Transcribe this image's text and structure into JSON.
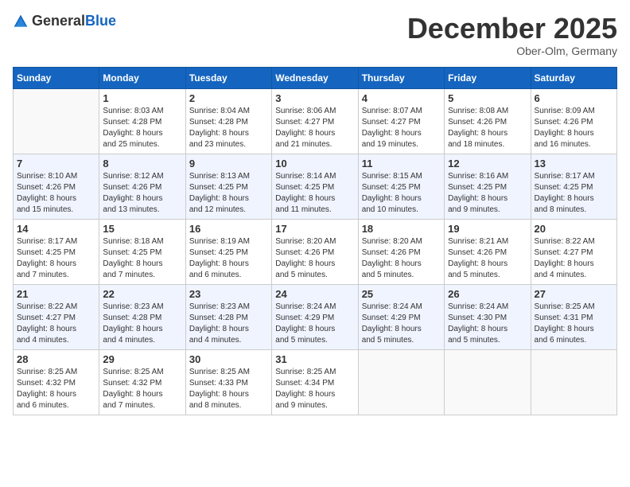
{
  "header": {
    "logo_general": "General",
    "logo_blue": "Blue",
    "month_title": "December 2025",
    "subtitle": "Ober-Olm, Germany"
  },
  "weekdays": [
    "Sunday",
    "Monday",
    "Tuesday",
    "Wednesday",
    "Thursday",
    "Friday",
    "Saturday"
  ],
  "weeks": [
    [
      {
        "day": "",
        "info": ""
      },
      {
        "day": "1",
        "info": "Sunrise: 8:03 AM\nSunset: 4:28 PM\nDaylight: 8 hours\nand 25 minutes."
      },
      {
        "day": "2",
        "info": "Sunrise: 8:04 AM\nSunset: 4:28 PM\nDaylight: 8 hours\nand 23 minutes."
      },
      {
        "day": "3",
        "info": "Sunrise: 8:06 AM\nSunset: 4:27 PM\nDaylight: 8 hours\nand 21 minutes."
      },
      {
        "day": "4",
        "info": "Sunrise: 8:07 AM\nSunset: 4:27 PM\nDaylight: 8 hours\nand 19 minutes."
      },
      {
        "day": "5",
        "info": "Sunrise: 8:08 AM\nSunset: 4:26 PM\nDaylight: 8 hours\nand 18 minutes."
      },
      {
        "day": "6",
        "info": "Sunrise: 8:09 AM\nSunset: 4:26 PM\nDaylight: 8 hours\nand 16 minutes."
      }
    ],
    [
      {
        "day": "7",
        "info": "Sunrise: 8:10 AM\nSunset: 4:26 PM\nDaylight: 8 hours\nand 15 minutes."
      },
      {
        "day": "8",
        "info": "Sunrise: 8:12 AM\nSunset: 4:26 PM\nDaylight: 8 hours\nand 13 minutes."
      },
      {
        "day": "9",
        "info": "Sunrise: 8:13 AM\nSunset: 4:25 PM\nDaylight: 8 hours\nand 12 minutes."
      },
      {
        "day": "10",
        "info": "Sunrise: 8:14 AM\nSunset: 4:25 PM\nDaylight: 8 hours\nand 11 minutes."
      },
      {
        "day": "11",
        "info": "Sunrise: 8:15 AM\nSunset: 4:25 PM\nDaylight: 8 hours\nand 10 minutes."
      },
      {
        "day": "12",
        "info": "Sunrise: 8:16 AM\nSunset: 4:25 PM\nDaylight: 8 hours\nand 9 minutes."
      },
      {
        "day": "13",
        "info": "Sunrise: 8:17 AM\nSunset: 4:25 PM\nDaylight: 8 hours\nand 8 minutes."
      }
    ],
    [
      {
        "day": "14",
        "info": "Sunrise: 8:17 AM\nSunset: 4:25 PM\nDaylight: 8 hours\nand 7 minutes."
      },
      {
        "day": "15",
        "info": "Sunrise: 8:18 AM\nSunset: 4:25 PM\nDaylight: 8 hours\nand 7 minutes."
      },
      {
        "day": "16",
        "info": "Sunrise: 8:19 AM\nSunset: 4:25 PM\nDaylight: 8 hours\nand 6 minutes."
      },
      {
        "day": "17",
        "info": "Sunrise: 8:20 AM\nSunset: 4:26 PM\nDaylight: 8 hours\nand 5 minutes."
      },
      {
        "day": "18",
        "info": "Sunrise: 8:20 AM\nSunset: 4:26 PM\nDaylight: 8 hours\nand 5 minutes."
      },
      {
        "day": "19",
        "info": "Sunrise: 8:21 AM\nSunset: 4:26 PM\nDaylight: 8 hours\nand 5 minutes."
      },
      {
        "day": "20",
        "info": "Sunrise: 8:22 AM\nSunset: 4:27 PM\nDaylight: 8 hours\nand 4 minutes."
      }
    ],
    [
      {
        "day": "21",
        "info": "Sunrise: 8:22 AM\nSunset: 4:27 PM\nDaylight: 8 hours\nand 4 minutes."
      },
      {
        "day": "22",
        "info": "Sunrise: 8:23 AM\nSunset: 4:28 PM\nDaylight: 8 hours\nand 4 minutes."
      },
      {
        "day": "23",
        "info": "Sunrise: 8:23 AM\nSunset: 4:28 PM\nDaylight: 8 hours\nand 4 minutes."
      },
      {
        "day": "24",
        "info": "Sunrise: 8:24 AM\nSunset: 4:29 PM\nDaylight: 8 hours\nand 5 minutes."
      },
      {
        "day": "25",
        "info": "Sunrise: 8:24 AM\nSunset: 4:29 PM\nDaylight: 8 hours\nand 5 minutes."
      },
      {
        "day": "26",
        "info": "Sunrise: 8:24 AM\nSunset: 4:30 PM\nDaylight: 8 hours\nand 5 minutes."
      },
      {
        "day": "27",
        "info": "Sunrise: 8:25 AM\nSunset: 4:31 PM\nDaylight: 8 hours\nand 6 minutes."
      }
    ],
    [
      {
        "day": "28",
        "info": "Sunrise: 8:25 AM\nSunset: 4:32 PM\nDaylight: 8 hours\nand 6 minutes."
      },
      {
        "day": "29",
        "info": "Sunrise: 8:25 AM\nSunset: 4:32 PM\nDaylight: 8 hours\nand 7 minutes."
      },
      {
        "day": "30",
        "info": "Sunrise: 8:25 AM\nSunset: 4:33 PM\nDaylight: 8 hours\nand 8 minutes."
      },
      {
        "day": "31",
        "info": "Sunrise: 8:25 AM\nSunset: 4:34 PM\nDaylight: 8 hours\nand 9 minutes."
      },
      {
        "day": "",
        "info": ""
      },
      {
        "day": "",
        "info": ""
      },
      {
        "day": "",
        "info": ""
      }
    ]
  ]
}
